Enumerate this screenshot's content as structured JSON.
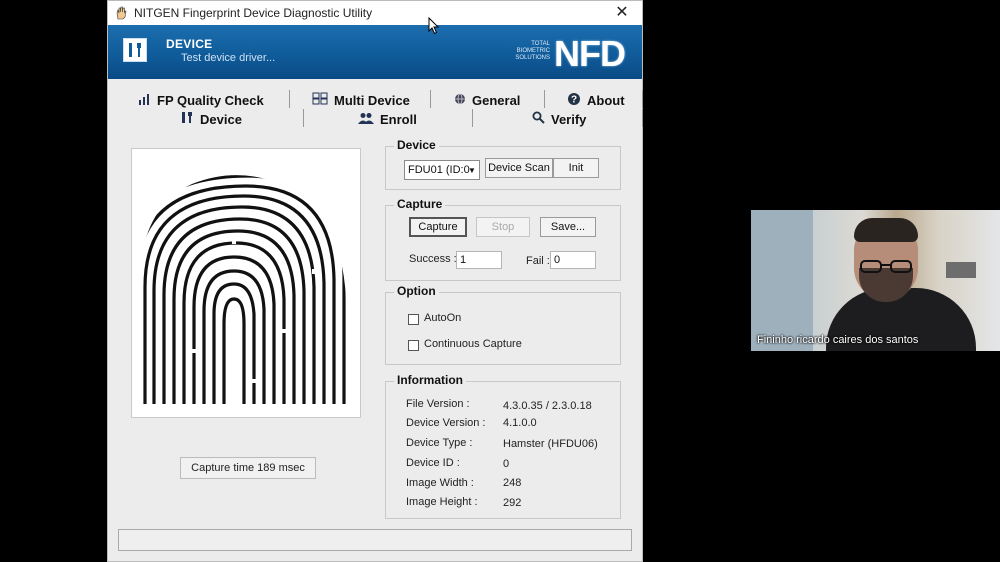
{
  "window": {
    "title": "NITGEN Fingerprint Device Diagnostic Utility",
    "close_glyph": "✕"
  },
  "banner": {
    "title": "DEVICE",
    "subtitle": "Test device driver...",
    "tagline": "TOTAL BIOMETRIC SOLUTIONS",
    "logo": "NFD"
  },
  "tabs": {
    "row1": [
      {
        "label": "FP Quality Check",
        "icon": "bar-chart-icon"
      },
      {
        "label": "Multi Device",
        "icon": "devices-icon"
      },
      {
        "label": "General",
        "icon": "globe-icon"
      },
      {
        "label": "About",
        "icon": "help-icon"
      }
    ],
    "row2": [
      {
        "label": "Device",
        "icon": "device-icon"
      },
      {
        "label": "Enroll",
        "icon": "users-icon"
      },
      {
        "label": "Verify",
        "icon": "magnifier-icon"
      }
    ]
  },
  "capture_time": "Capture time 189 msec",
  "device_group": {
    "legend": "Device",
    "select_value": "FDU01 (ID:0",
    "scan_button": "Device Scan",
    "init_button": "Init"
  },
  "capture_group": {
    "legend": "Capture",
    "capture_button": "Capture",
    "stop_button": "Stop",
    "save_button": "Save...",
    "success_label": "Success :",
    "success_value": "1",
    "fail_label": "Fail :",
    "fail_value": "0"
  },
  "option_group": {
    "legend": "Option",
    "autoon_label": "AutoOn",
    "autoon_checked": false,
    "continuous_label": "Continuous Capture",
    "continuous_checked": false
  },
  "info_group": {
    "legend": "Information",
    "rows": [
      {
        "label": "File Version :",
        "value": "4.3.0.35 / 2.3.0.18"
      },
      {
        "label": "Device Version :",
        "value": "4.1.0.0"
      },
      {
        "label": "Device Type :",
        "value": "Hamster (HFDU06)"
      },
      {
        "label": "Device ID :",
        "value": "0"
      },
      {
        "label": "Image Width :",
        "value": "248"
      },
      {
        "label": "Image Height :",
        "value": "292"
      }
    ]
  },
  "video": {
    "participant_name": "Fininho ricardo caires dos santos"
  }
}
